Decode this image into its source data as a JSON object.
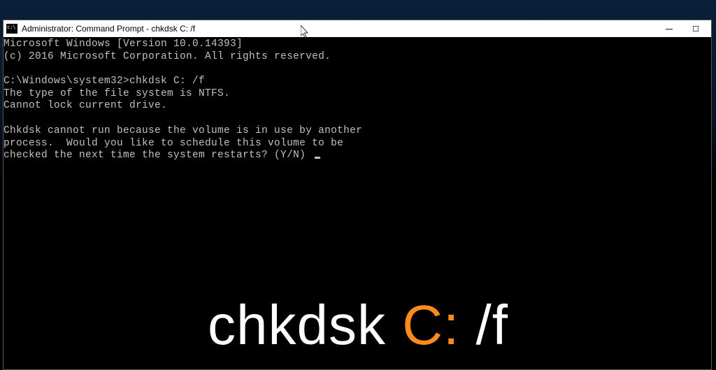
{
  "window": {
    "title": "Administrator: Command Prompt - chkdsk  C: /f"
  },
  "terminal": {
    "line1": "Microsoft Windows [Version 10.0.14393]",
    "line2": "(c) 2016 Microsoft Corporation. All rights reserved.",
    "blank1": "",
    "prompt_path": "C:\\Windows\\system32>",
    "prompt_cmd": "chkdsk C: /f",
    "line3": "The type of the file system is NTFS.",
    "line4": "Cannot lock current drive.",
    "blank2": "",
    "line5": "Chkdsk cannot run because the volume is in use by another",
    "line6": "process.  Would you like to schedule this volume to be",
    "line7": "checked the next time the system restarts? (Y/N) "
  },
  "caption": {
    "part1": "chkdsk ",
    "accent": "C:",
    "part2": " /f"
  },
  "colors": {
    "accent": "#ff8c1a",
    "terminal_fg": "#c0c0c0",
    "terminal_bg": "#000000"
  }
}
